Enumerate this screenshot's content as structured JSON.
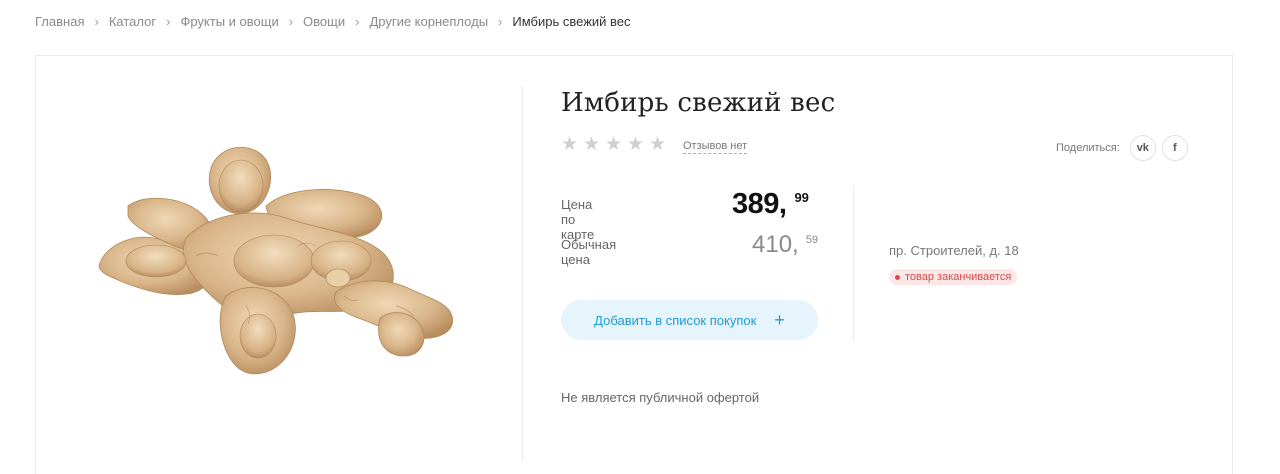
{
  "breadcrumb": {
    "items": [
      "Главная",
      "Каталог",
      "Фрукты и овощи",
      "Овощи",
      "Другие корнеплоды"
    ],
    "current": "Имбирь свежий вес"
  },
  "product": {
    "title": "Имбирь свежий вес",
    "rating_stars": 0,
    "reviews_link": "Отзывов нет",
    "share_label": "Поделиться:",
    "share_vk": "vk",
    "share_fb": "f",
    "card_price_label": "Цена по карте",
    "card_price_int": "389,",
    "card_price_frac": "99",
    "regular_price_label": "Обычная цена",
    "regular_price_int": "410,",
    "regular_price_frac": "59",
    "add_button_label": "Добавить в список покупок",
    "add_button_icon": "+",
    "store_address": "пр. Строителей, д. 18",
    "stock_status": "товар заканчивается",
    "disclaimer": "Не является публичной офертой"
  },
  "colors": {
    "accent": "#1f9ad6",
    "button_bg": "#e6f5fb",
    "stock_bg": "#fde6e6",
    "stock_text": "#d34e4e",
    "star_inactive": "#cfcfcf"
  }
}
